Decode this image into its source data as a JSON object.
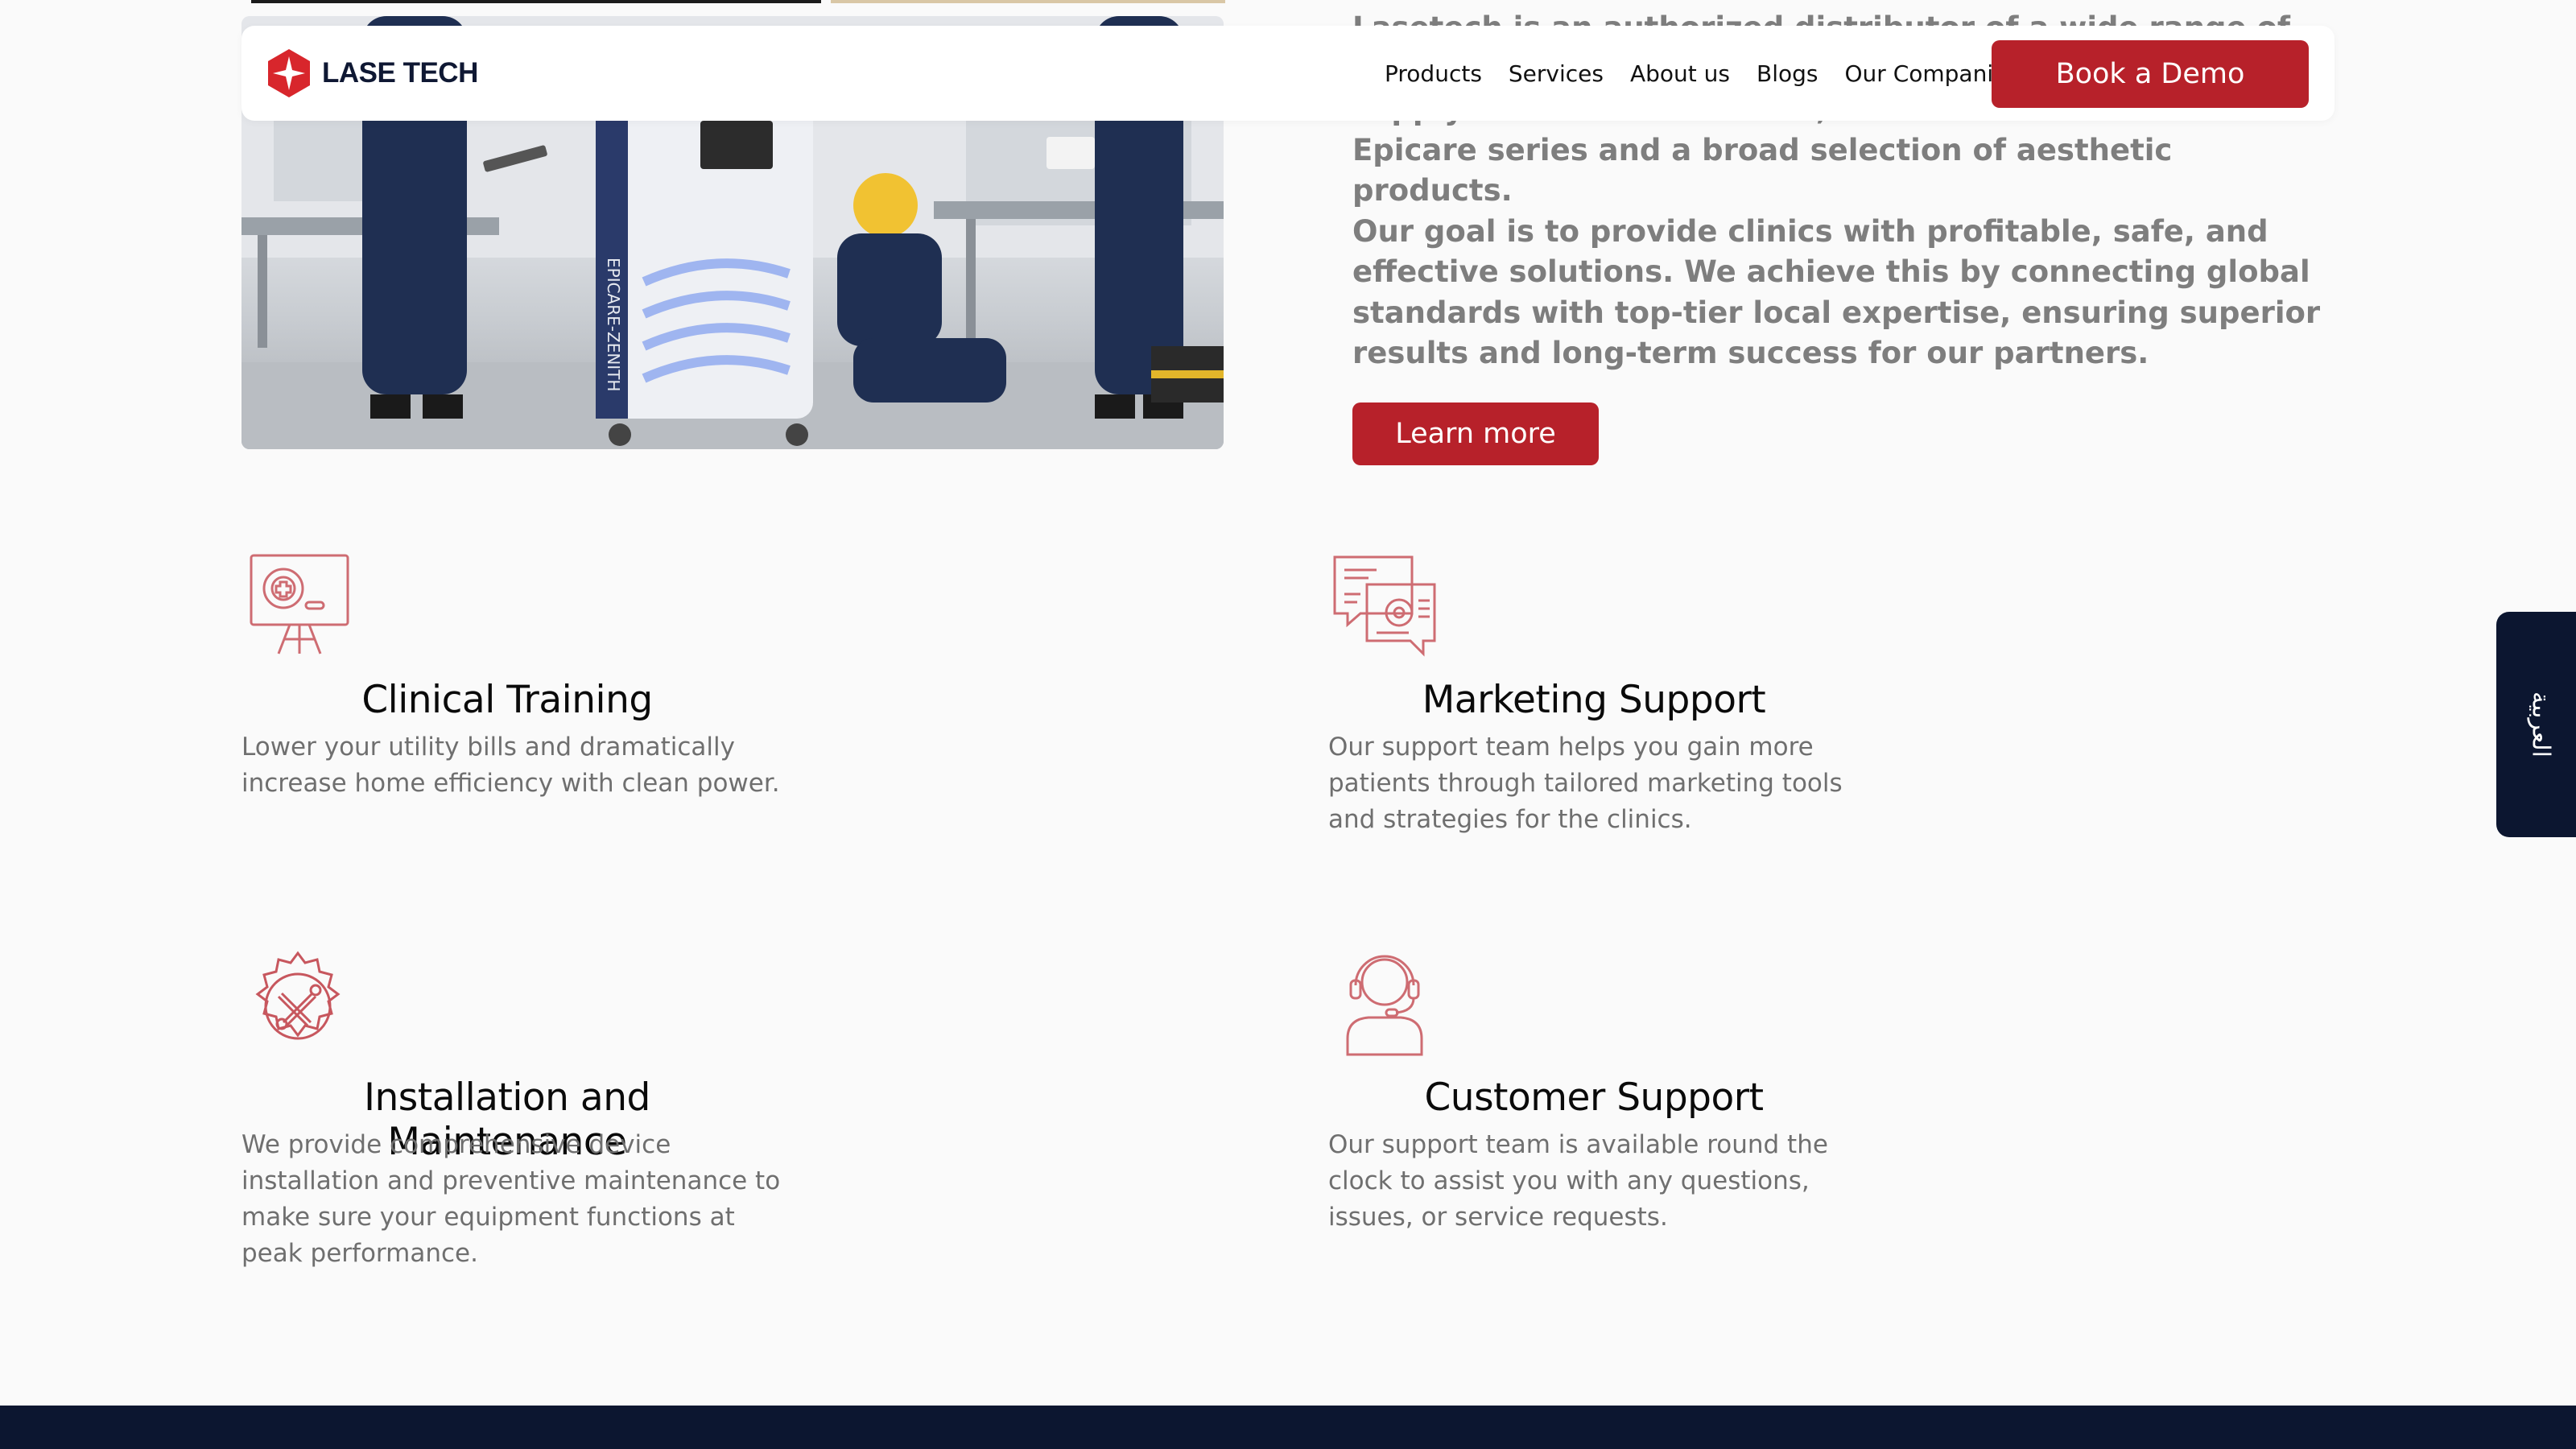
{
  "navbar": {
    "brand": "LASE TECH",
    "links": [
      "Products",
      "Services",
      "About us",
      "Blogs",
      "Our Companies"
    ],
    "cta": "Book a Demo"
  },
  "about": {
    "paragraphs": [
      "Lasetech is an authorized distributor of a wide range of cutting-edge technologies. Through our partnership, we supply FDA-cleared devices, such as the renowned Epicare series and a broad selection of aesthetic products.",
      "Our goal is to provide clinics with profitable, safe, and effective solutions. We achieve this by connecting global standards with top-tier local expertise, ensuring superior results and long-term success for our partners."
    ],
    "button": "Learn more"
  },
  "hero_image": {
    "device_label": "EPICARE-ZENITH"
  },
  "services": [
    {
      "icon": "training-board-icon",
      "title": "Clinical Training",
      "description": "Lower your utility bills and dramatically increase home efficiency with clean power."
    },
    {
      "icon": "marketing-gear-chat-icon",
      "title": "Marketing Support",
      "description": "Our support team helps you gain more patients through tailored marketing tools and strategies for the clinics."
    },
    {
      "icon": "wrench-gear-icon",
      "title": "Installation and Maintenance",
      "description": "We provide comprehensive device installation and preventive maintenance to make sure your equipment functions at peak performance."
    },
    {
      "icon": "headset-agent-icon",
      "title": "Customer Support",
      "description": "Our support team is available round the clock to assist you with any questions, issues, or service requests."
    }
  ],
  "language_tab": "العربية",
  "colors": {
    "accent": "#b7212a",
    "navy": "#0c1630",
    "body_text": "#7e7e7e",
    "background": "#fafafa"
  }
}
